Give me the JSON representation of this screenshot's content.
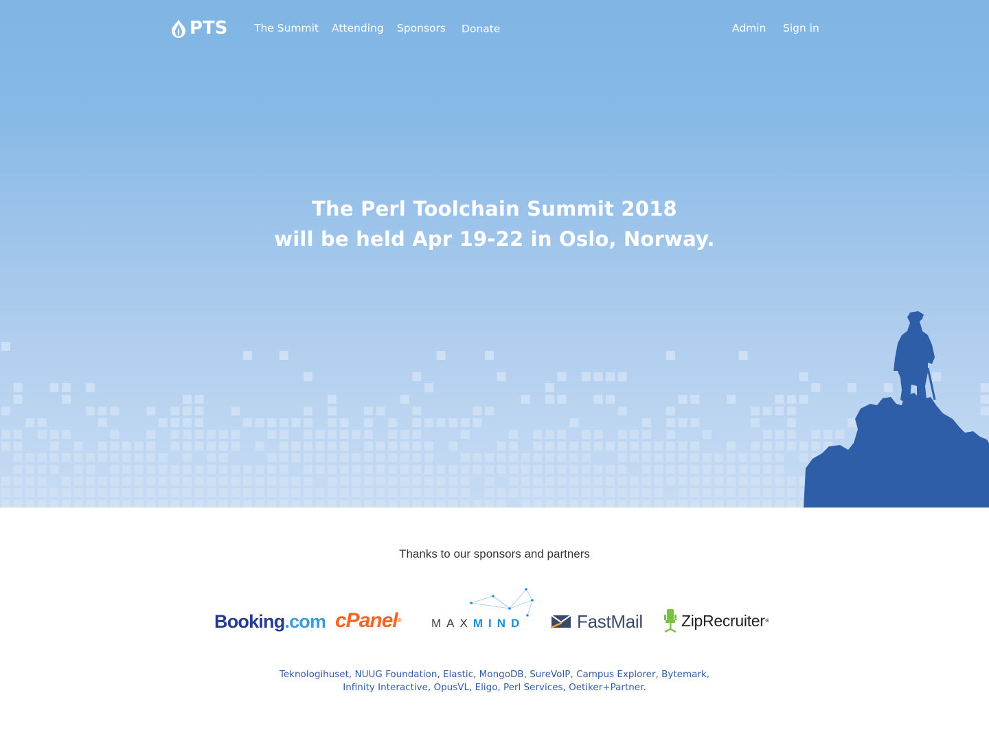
{
  "nav": {
    "brand": "PTS",
    "links": [
      "The Summit",
      "Attending",
      "Sponsors",
      "Donate"
    ],
    "admin": "Admin",
    "signin": "Sign in"
  },
  "hero": {
    "line1": "The Perl Toolchain Summit 2018",
    "line2": "will be held Apr 19-22 in Oslo, Norway."
  },
  "sponsors": {
    "heading": "Thanks to our sponsors and partners",
    "logos": {
      "booking_main": "Booking",
      "booking_dotcom": ".com",
      "cpanel": "cPanel",
      "cpanel_mark": "®",
      "maxmind_max": "MAX",
      "maxmind_mind": "MIND",
      "fastmail": "FastMail",
      "ziprecruiter": "ZipRecruiter",
      "ziprecruiter_mark": "®"
    },
    "others_line1": "Teknologihuset, NUUG Foundation, Elastic, MongoDB, SureVoIP, Campus Explorer, Bytemark,",
    "others_line2": "Infinity Interactive, OpusVL, Eligo, Perl Services, Oetiker+Partner."
  },
  "colors": {
    "hero_top": "#80b5e4",
    "hero_bottom": "#c7dcf3",
    "climber": "#2e5ea8",
    "link": "#2f5ca3",
    "booking": "#263a8f",
    "cpanel": "#f26522",
    "maxmind": "#1b8fd6",
    "ziprecruiter": "#7ac143"
  },
  "icons": [
    "pts-onion-icon",
    "fastmail-envelope-icon",
    "ziprecruiter-chair-icon",
    "maxmind-network-icon",
    "climber-silhouette"
  ]
}
